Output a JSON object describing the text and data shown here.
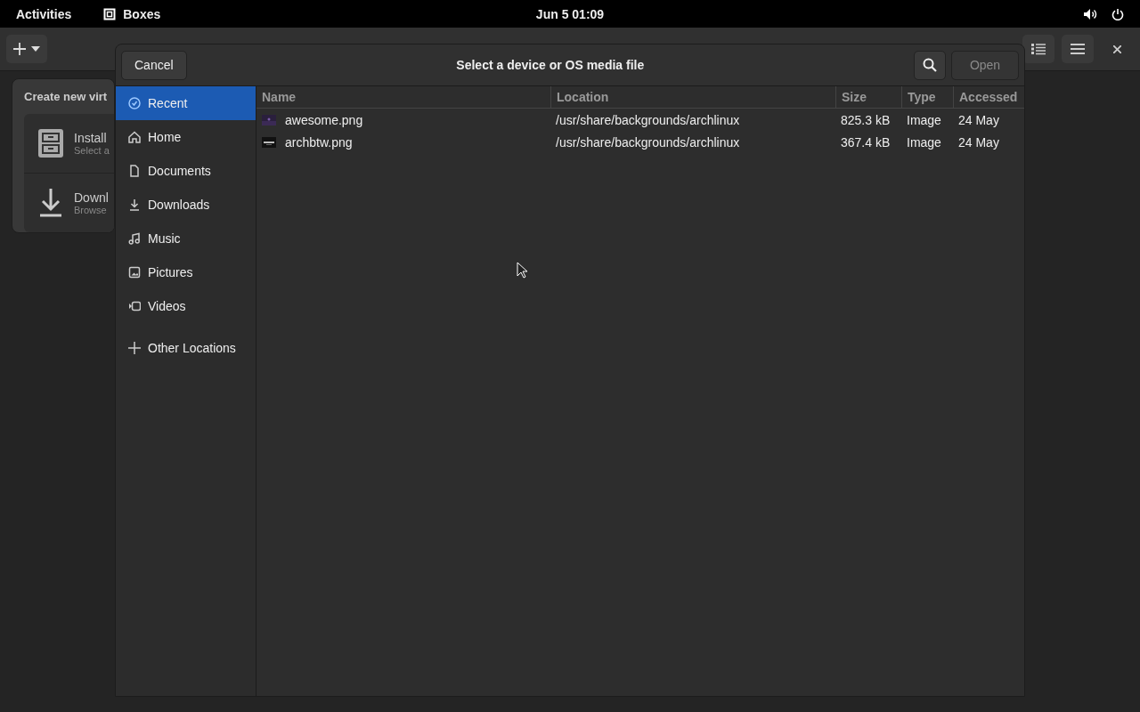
{
  "top_bar": {
    "activities": "Activities",
    "app_name": "Boxes",
    "clock": "Jun 5  01:09"
  },
  "popover": {
    "title": "Create new virt",
    "items": [
      {
        "title": "Install",
        "subtitle": "Select a"
      },
      {
        "title": "Downl",
        "subtitle": "Browse"
      }
    ]
  },
  "dialog": {
    "title": "Select a device or OS media file",
    "cancel": "Cancel",
    "open": {
      "label": "Open",
      "disabled": true
    },
    "sidebar": {
      "items": [
        {
          "label": "Recent",
          "selected": true
        },
        {
          "label": "Home",
          "selected": false
        },
        {
          "label": "Documents",
          "selected": false
        },
        {
          "label": "Downloads",
          "selected": false
        },
        {
          "label": "Music",
          "selected": false
        },
        {
          "label": "Pictures",
          "selected": false
        },
        {
          "label": "Videos",
          "selected": false
        }
      ],
      "other": "Other Locations"
    },
    "table": {
      "columns": [
        "Name",
        "Location",
        "Size",
        "Type",
        "Accessed"
      ],
      "rows": [
        {
          "name": "awesome.png",
          "location": "/usr/share/backgrounds/archlinux",
          "size": "825.3 kB",
          "type": "Image",
          "accessed": "24 May"
        },
        {
          "name": "archbtw.png",
          "location": "/usr/share/backgrounds/archlinux",
          "size": "367.4 kB",
          "type": "Image",
          "accessed": "24 May"
        }
      ]
    }
  }
}
